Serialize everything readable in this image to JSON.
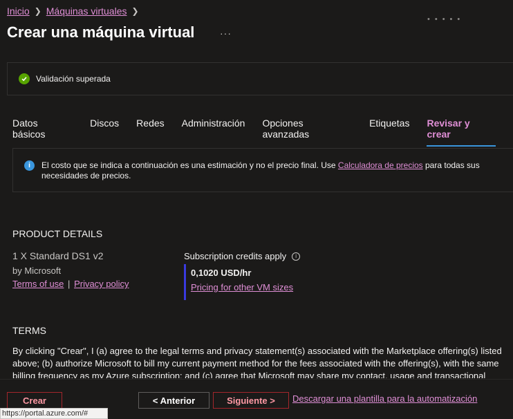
{
  "breadcrumb": {
    "items": [
      "Inicio",
      "Máquinas virtuales"
    ]
  },
  "page": {
    "title": "Crear una máquina virtual",
    "more": "···"
  },
  "validation": {
    "text": "Validación superada"
  },
  "tabs": [
    {
      "label": "Datos básicos",
      "active": false
    },
    {
      "label": "Discos",
      "active": false
    },
    {
      "label": "Redes",
      "active": false
    },
    {
      "label": "Administración",
      "active": false
    },
    {
      "label": "Opciones avanzadas",
      "active": false
    },
    {
      "label": "Etiquetas",
      "active": false
    },
    {
      "label": "Revisar y crear",
      "active": true
    }
  ],
  "info": {
    "text_before": "El costo que se indica a continuación es una estimación y no el precio final. Use ",
    "link": "Calculadora de precios",
    "text_after": " para todas sus necesidades de precios."
  },
  "product": {
    "heading": "PRODUCT DETAILS",
    "name": "1 X Standard DS1 v2",
    "by": "by Microsoft",
    "terms_link": "Terms of use",
    "separator": "|",
    "privacy_link": "Privacy policy",
    "credits_label": "Subscription credits apply",
    "price": "0,1020 USD/hr",
    "pricing_link": "Pricing for other VM sizes"
  },
  "terms": {
    "heading": "TERMS",
    "text": "By clicking \"Crear\", I (a) agree to the legal terms and privacy statement(s) associated with the Marketplace offering(s) listed above; (b) authorize Microsoft to bill my current payment method for the fees associated with the offering(s), with the same billing frequency as my Azure subscription; and (c) agree that Microsoft may share my contact, usage and transactional"
  },
  "footer": {
    "create": "Crear",
    "previous": "< Anterior",
    "next": "Siguiente >",
    "download": "Descargar una plantilla para la automatización"
  },
  "status_url": "https://portal.azure.com/#",
  "colors": {
    "background": "#1b1a19",
    "link": "#e08fd6",
    "tab_underline": "#3a96dd",
    "success": "#57a300",
    "danger_border": "#a4262c"
  }
}
